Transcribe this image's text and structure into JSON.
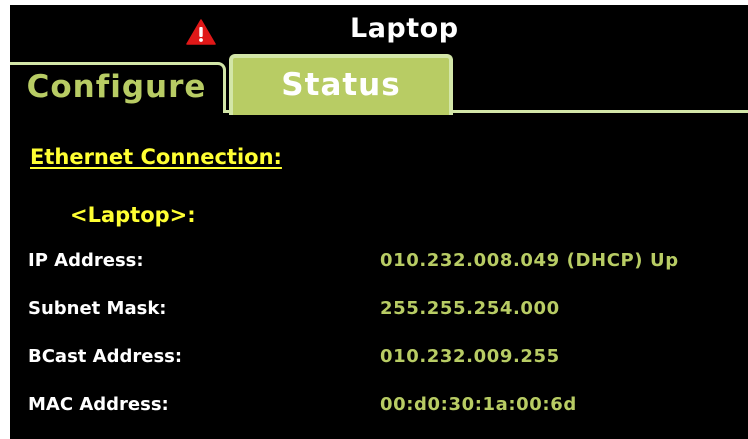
{
  "header": {
    "title": "Laptop",
    "warning_icon": "warning-triangle-icon",
    "warning_color": "#e01818"
  },
  "tabs": [
    {
      "label": "Configure",
      "active": false
    },
    {
      "label": "Status",
      "active": true
    }
  ],
  "colors": {
    "background": "#000000",
    "accent_green": "#b8cc64",
    "tab_border": "#d3e6a8",
    "heading_yellow": "#ffff33",
    "label_white": "#ffffff"
  },
  "status": {
    "section_title": "Ethernet Connection:",
    "device_name": "<Laptop>:",
    "rows": [
      {
        "label": "IP Address:",
        "value": "010.232.008.049 (DHCP) Up"
      },
      {
        "label": "Subnet Mask:",
        "value": "255.255.254.000"
      },
      {
        "label": "BCast Address:",
        "value": "010.232.009.255"
      },
      {
        "label": "MAC Address:",
        "value": "00:d0:30:1a:00:6d"
      }
    ]
  }
}
